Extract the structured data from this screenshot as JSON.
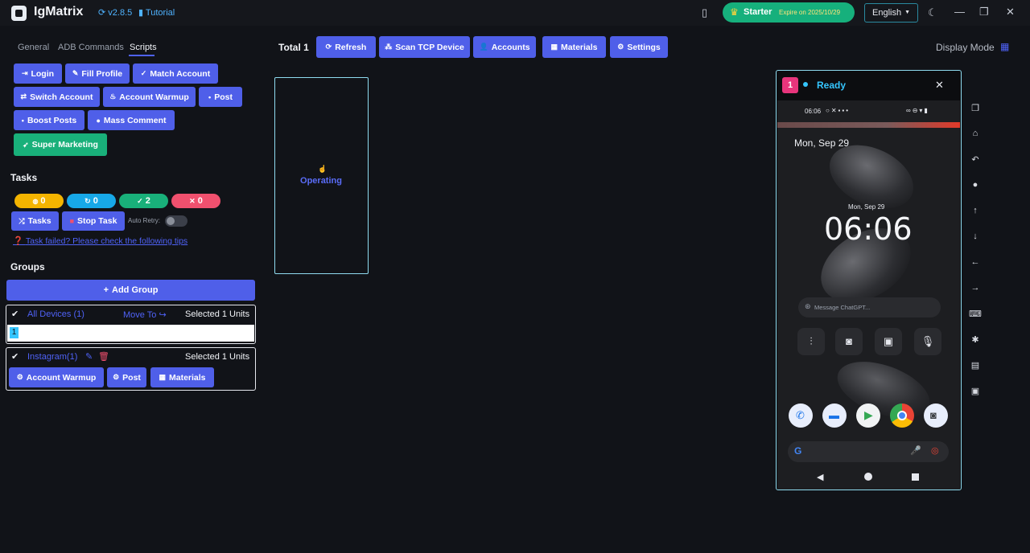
{
  "app": {
    "name": "IgMatrix",
    "version": "v2.8.5",
    "tutorial_label": "Tutorial",
    "plan_name": "Starter",
    "plan_expiry": "Expire on 2025/10/29",
    "language": "English"
  },
  "tabs": [
    "General",
    "ADB Commands",
    "Scripts"
  ],
  "scripts": {
    "login": "Login",
    "fill_profile": "Fill Profile",
    "match_account": "Match Account",
    "switch_account": "Switch Account",
    "account_warmup": "Account Warmup",
    "post": "Post",
    "boost_posts": "Boost Posts",
    "mass_comment": "Mass Comment",
    "super_marketing": "Super Marketing"
  },
  "tasks": {
    "title": "Tasks",
    "counts": {
      "running": "0",
      "pending": "0",
      "success": "2",
      "failed": "0"
    },
    "tasks_button": "Tasks",
    "stop_button": "Stop Task",
    "auto_retry_label": "Auto Retry:",
    "help_link": "Task failed? Please check the following tips"
  },
  "groups": {
    "title": "Groups",
    "add_group": "Add Group",
    "all_devices": {
      "label": "All Devices (1)",
      "move_to": "Move To",
      "selected": "Selected 1 Units",
      "device_tag": "1"
    },
    "instagram": {
      "label": "Instagram(1)",
      "selected": "Selected 1 Units",
      "actions": [
        "Account Warmup",
        "Post",
        "Materials"
      ]
    }
  },
  "toolbar": {
    "total": "Total 1",
    "refresh": "Refresh",
    "scan_tcp": "Scan TCP Device",
    "accounts": "Accounts",
    "materials": "Materials",
    "settings": "Settings",
    "display_mode": "Display Mode"
  },
  "device_card": {
    "status": "Operating"
  },
  "phone": {
    "index": "1",
    "status": "Ready",
    "status_time": "06:06",
    "date_large": "Mon, Sep 29",
    "date_small": "Mon, Sep 29",
    "clock": "06:06",
    "chat_placeholder": "Message ChatGPT..."
  },
  "colors": {
    "accent": "#4f5fe9",
    "success": "#19b07a",
    "ready": "#35c6ff",
    "badge": "#e8357c",
    "warning": "#f4b400",
    "danger": "#f0506e"
  }
}
